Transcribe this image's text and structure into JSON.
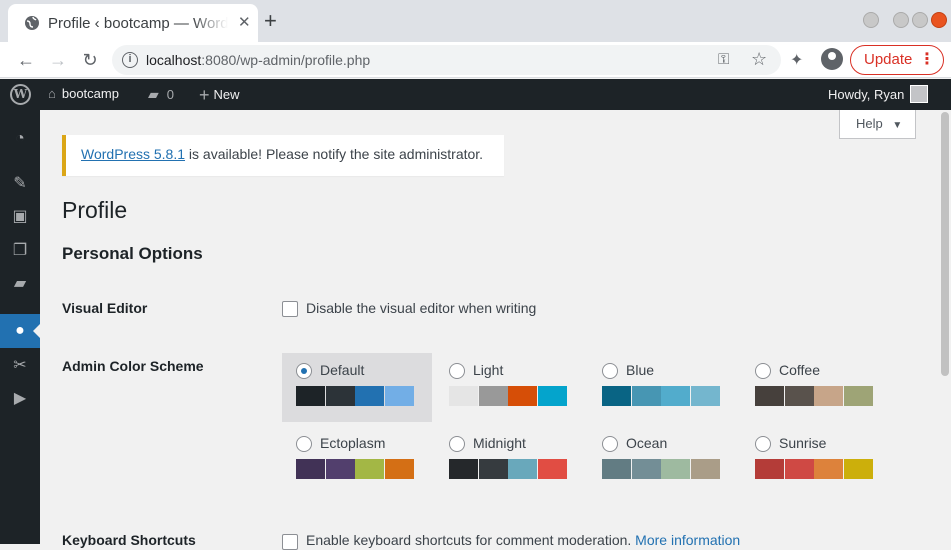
{
  "browser": {
    "tab_title": "Profile ‹ bootcamp — WordPress",
    "url_host": "localhost",
    "url_rest": ":8080/wp-admin/profile.php",
    "update_label": "Update"
  },
  "adminbar": {
    "site_name": "bootcamp",
    "comments_count": "0",
    "new_label": "New",
    "howdy": "Howdy, Ryan"
  },
  "help_label": "Help",
  "notice": {
    "link_text": "WordPress 5.8.1",
    "text": " is available! Please notify the site administrator."
  },
  "page_title": "Profile",
  "section_title": "Personal Options",
  "visual_editor": {
    "label": "Visual Editor",
    "checkbox_text": "Disable the visual editor when writing"
  },
  "color_scheme": {
    "label": "Admin Color Scheme",
    "schemes": [
      {
        "name": "Default",
        "colors": [
          "#1d2327",
          "#2c3338",
          "#2271b1",
          "#72aee6"
        ]
      },
      {
        "name": "Light",
        "colors": [
          "#e5e5e5",
          "#999999",
          "#d64e07",
          "#04a4cc"
        ]
      },
      {
        "name": "Blue",
        "colors": [
          "#096484",
          "#4796b3",
          "#52accc",
          "#74b6ce"
        ]
      },
      {
        "name": "Coffee",
        "colors": [
          "#46403c",
          "#59524c",
          "#c7a589",
          "#9ea476"
        ]
      },
      {
        "name": "Ectoplasm",
        "colors": [
          "#413256",
          "#523f6d",
          "#a3b745",
          "#d46f15"
        ]
      },
      {
        "name": "Midnight",
        "colors": [
          "#25282b",
          "#363b3f",
          "#69a8bb",
          "#e14d43"
        ]
      },
      {
        "name": "Ocean",
        "colors": [
          "#627c83",
          "#738e96",
          "#9ebaa0",
          "#aa9d88"
        ]
      },
      {
        "name": "Sunrise",
        "colors": [
          "#b43c38",
          "#cf4944",
          "#dd823b",
          "#ccaf0b"
        ]
      }
    ],
    "selected": "Default"
  },
  "keyboard_shortcuts": {
    "label": "Keyboard Shortcuts",
    "checkbox_text": "Enable keyboard shortcuts for comment moderation.",
    "link_text": "More information"
  }
}
